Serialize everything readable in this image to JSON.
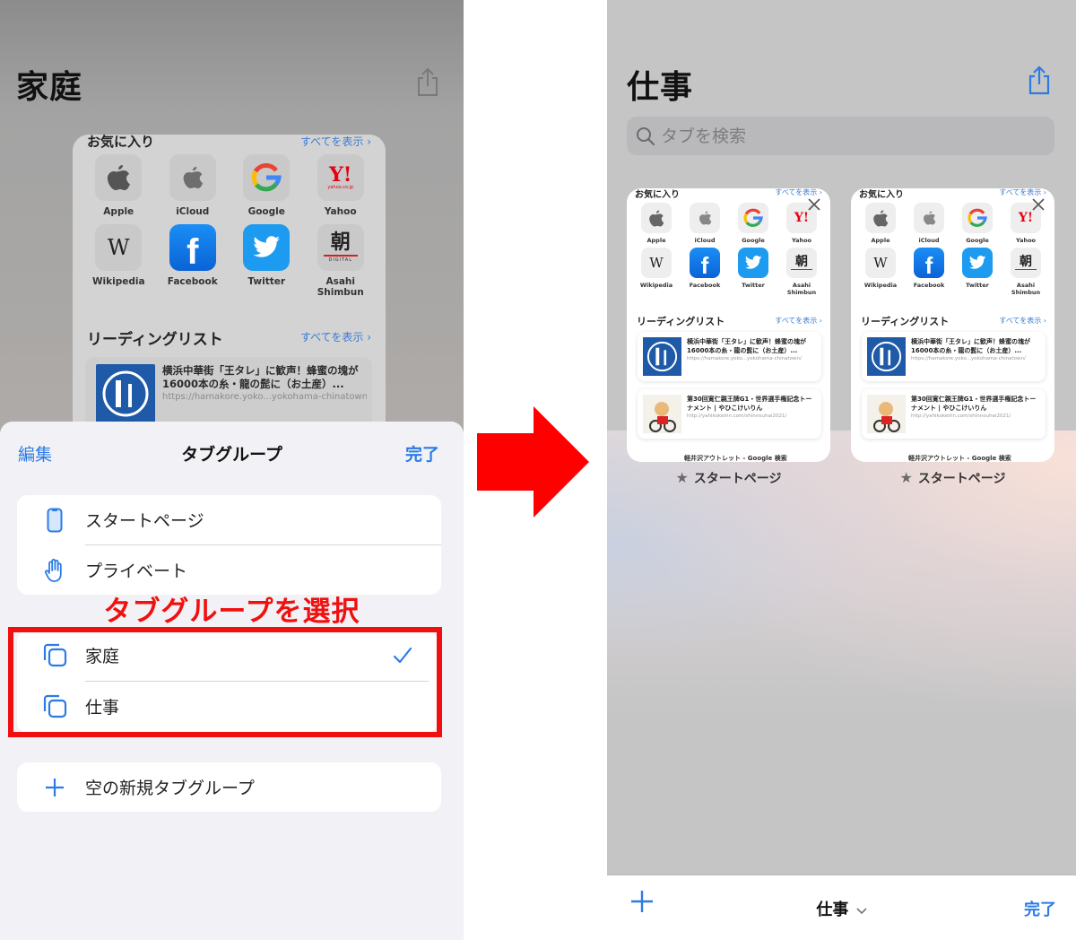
{
  "left_screen": {
    "title": "家庭",
    "start_page": {
      "favorites_heading": "お気に入り",
      "show_all": "すべてを表示 ›",
      "favorites": [
        {
          "label": "Apple",
          "icon": "apple-icon"
        },
        {
          "label": "iCloud",
          "icon": "apple-icon"
        },
        {
          "label": "Google",
          "icon": "google-icon"
        },
        {
          "label": "Yahoo",
          "icon": "yahoo-icon"
        },
        {
          "label": "Wikipedia",
          "icon": "wikipedia-icon"
        },
        {
          "label": "Facebook",
          "icon": "facebook-icon"
        },
        {
          "label": "Twitter",
          "icon": "twitter-icon"
        },
        {
          "label": "Asahi Shimbun",
          "icon": "asahi-icon"
        }
      ],
      "reading_list_heading": "リーディングリスト",
      "reading_list_show_all": "すべてを表示 ›",
      "reading_list": [
        {
          "title": "横浜中華街「王タレ」に歓声！蜂蜜の塊が16000本の糸・龍の髭に（お土産）...",
          "url": "https://hamakore.yoko...yokohama-chinatown/"
        }
      ]
    },
    "sheet": {
      "edit": "編集",
      "title": "タブグループ",
      "done": "完了",
      "section1": [
        {
          "label": "スタートページ",
          "icon": "phone-icon"
        },
        {
          "label": "プライベート",
          "icon": "hand-icon"
        }
      ],
      "annotation": "タブグループを選択",
      "section2": [
        {
          "label": "家庭",
          "icon": "tab-group-icon",
          "selected": true
        },
        {
          "label": "仕事",
          "icon": "tab-group-icon",
          "selected": false
        }
      ],
      "new_group": "空の新規タブグループ"
    }
  },
  "right_screen": {
    "title": "仕事",
    "search_placeholder": "タブを検索",
    "tabs": [
      {
        "label": "スタートページ",
        "favorites_heading": "お気に入り",
        "show_all": "すべてを表示 ›",
        "favorites": [
          "Apple",
          "iCloud",
          "Google",
          "Yahoo",
          "Wikipedia",
          "Facebook",
          "Twitter",
          "Asahi Shimbun"
        ],
        "reading_list_heading": "リーディングリスト",
        "reading_list_show_all": "すべてを表示 ›",
        "reading_list": [
          {
            "title": "横浜中華街「王タレ」に歓声！蜂蜜の塊が16000本の糸・龍の髭に（お土産）...",
            "url": "https://hamakore.yoko...yokohama-chinatown/"
          },
          {
            "title": "第30回寛仁親王牌G1・世界選手権記念トーナメント | やひこけいりん",
            "url": "http://yahikokeirin.com/shinnouhai2021/"
          }
        ],
        "last_item": "軽井沢アウトレット - Google 検索"
      },
      {
        "label": "スタートページ",
        "favorites_heading": "お気に入り",
        "show_all": "すべてを表示 ›",
        "favorites": [
          "Apple",
          "iCloud",
          "Google",
          "Yahoo",
          "Wikipedia",
          "Facebook",
          "Twitter",
          "Asahi Shimbun"
        ],
        "reading_list_heading": "リーディングリスト",
        "reading_list_show_all": "すべてを表示 ›",
        "reading_list": [
          {
            "title": "横浜中華街「王タレ」に歓声！蜂蜜の塊が16000本の糸・龍の髭に（お土産）...",
            "url": "https://hamakore.yoko...yokohama-chinatown/"
          },
          {
            "title": "第30回寛仁親王牌G1・世界選手権記念トーナメント | やひこけいりん",
            "url": "http://yahikokeirin.com/shinnouhai2021/"
          }
        ],
        "last_item": "軽井沢アウトレット - Google 検索"
      }
    ],
    "toolbar": {
      "group_name": "仕事",
      "done": "完了"
    }
  },
  "colors": {
    "accent_blue": "#2c7be5",
    "annotation_red": "#f01010"
  }
}
